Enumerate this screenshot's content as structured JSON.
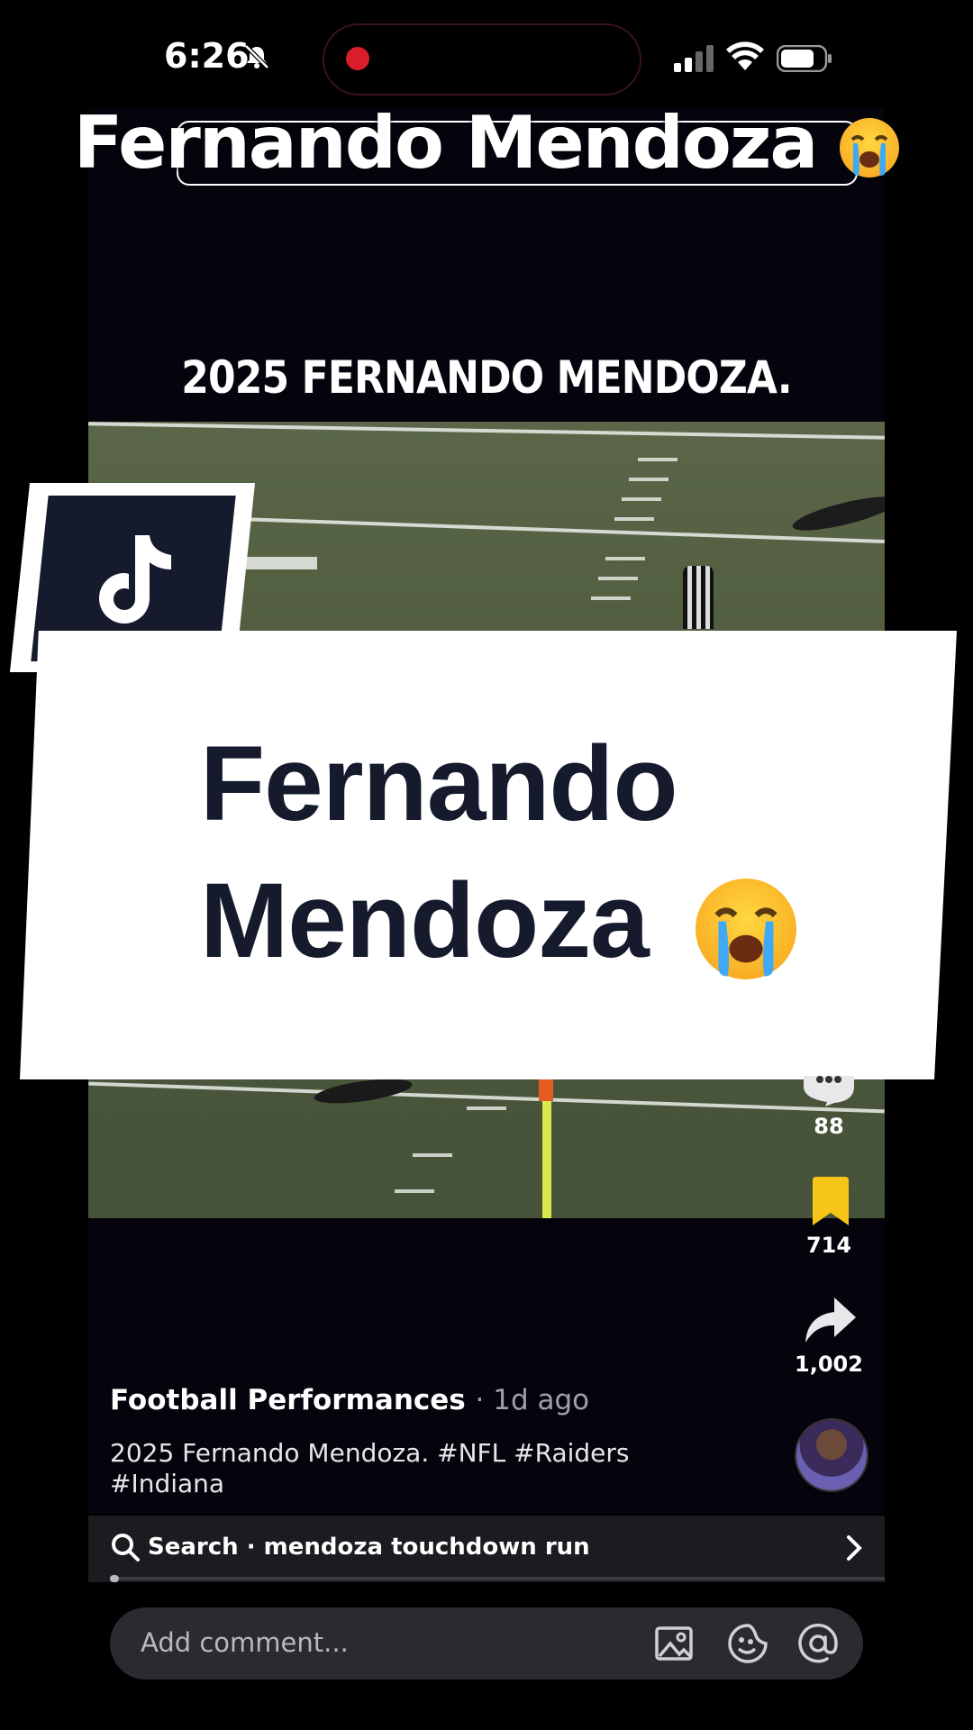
{
  "status_bar": {
    "time": "6:26"
  },
  "overlay_title": {
    "text": "Fernando Mendoza"
  },
  "video": {
    "caption_top": "2025 FERNANDO MENDOZA."
  },
  "banner": {
    "line1": "Fernando",
    "line2": "Mendoza"
  },
  "actions": {
    "comments": "88",
    "saves": "714",
    "shares": "1,002"
  },
  "post": {
    "author": "Football Performances",
    "time_ago": "· 1d ago",
    "caption": "2025 Fernando Mendoza. #NFL #Raiders #Indiana"
  },
  "search": {
    "text": "Search · mendoza touchdown run"
  },
  "comment": {
    "placeholder": "Add comment..."
  },
  "colors": {
    "save_accent": "#f5c518",
    "record_dot": "#d81e2b",
    "banner_text": "#151a2c"
  },
  "icons": [
    "mute-icon",
    "signal-icon",
    "wifi-icon",
    "battery-icon",
    "tiktok-icon",
    "comment-icon",
    "bookmark-icon",
    "share-icon",
    "search-icon",
    "chevron-right-icon",
    "image-icon",
    "sticker-icon",
    "mention-icon"
  ]
}
